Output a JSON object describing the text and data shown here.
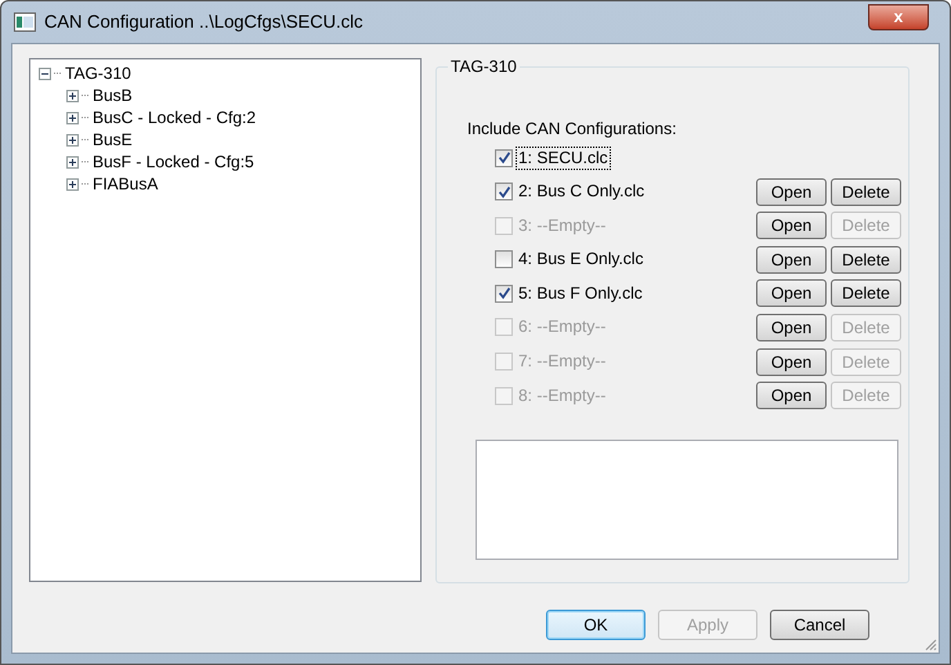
{
  "window": {
    "title": "CAN Configuration ..\\LogCfgs\\SECU.clc",
    "close": "x"
  },
  "tree": {
    "label": "TAG-310",
    "expanded": true,
    "children": [
      {
        "label": "BusB",
        "expanded": false
      },
      {
        "label": "BusC - Locked - Cfg:2",
        "expanded": false
      },
      {
        "label": "BusE",
        "expanded": false
      },
      {
        "label": "BusF - Locked - Cfg:5",
        "expanded": false
      },
      {
        "label": "FIABusA",
        "expanded": false
      }
    ]
  },
  "group": {
    "title": "TAG-310",
    "heading": "Include CAN Configurations:",
    "rows": [
      {
        "label": "1: SECU.clc",
        "checked": true,
        "disabled": false,
        "focused": true
      },
      {
        "label": "2: Bus C Only.clc",
        "checked": true,
        "disabled": false,
        "focused": false,
        "open": "Open",
        "delete": "Delete",
        "delete_disabled": false
      },
      {
        "label": "3: --Empty--",
        "checked": false,
        "disabled": true,
        "focused": false,
        "open": "Open",
        "delete": "Delete",
        "delete_disabled": true
      },
      {
        "label": "4: Bus E Only.clc",
        "checked": false,
        "disabled": false,
        "focused": false,
        "open": "Open",
        "delete": "Delete",
        "delete_disabled": false
      },
      {
        "label": "5: Bus F Only.clc",
        "checked": true,
        "disabled": false,
        "focused": false,
        "open": "Open",
        "delete": "Delete",
        "delete_disabled": false
      },
      {
        "label": "6: --Empty--",
        "checked": false,
        "disabled": true,
        "focused": false,
        "open": "Open",
        "delete": "Delete",
        "delete_disabled": true
      },
      {
        "label": "7: --Empty--",
        "checked": false,
        "disabled": true,
        "focused": false,
        "open": "Open",
        "delete": "Delete",
        "delete_disabled": true
      },
      {
        "label": "8: --Empty--",
        "checked": false,
        "disabled": true,
        "focused": false,
        "open": "Open",
        "delete": "Delete",
        "delete_disabled": true
      }
    ]
  },
  "buttons": [
    {
      "label": "OK",
      "default": true,
      "disabled": false
    },
    {
      "label": "Apply",
      "default": false,
      "disabled": true
    },
    {
      "label": "Cancel",
      "default": false,
      "disabled": false
    }
  ]
}
